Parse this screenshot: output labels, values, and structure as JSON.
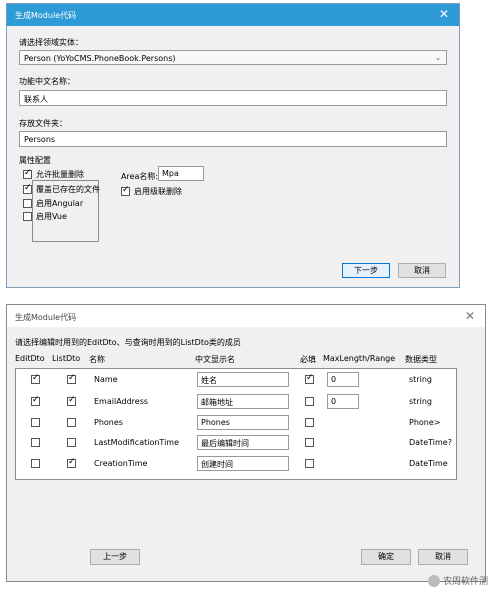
{
  "dialog1": {
    "title": "生成Module代码",
    "entity_label": "请选择领域实体：",
    "entity_value": "Person (YoYoCMS.PhoneBook.Persons)",
    "cn_name_label": "功能中文名称：",
    "cn_name_value": "联系人",
    "folder_label": "存放文件夹：",
    "folder_value": "Persons",
    "props_label": "属性配置",
    "options": [
      {
        "label": "允许批量删除",
        "checked": true
      },
      {
        "label": "覆盖已存在的文件",
        "checked": true
      },
      {
        "label": "启用Angular",
        "checked": false
      },
      {
        "label": "启用Vue",
        "checked": false
      }
    ],
    "area_label": "Area名称:",
    "area_value": "Mpa",
    "cascade_label": "启用级联删除",
    "cascade_checked": true,
    "next_button": "下一步",
    "cancel_button": "取消"
  },
  "dialog2": {
    "title": "生成Module代码",
    "instruction": "请选择编辑时用到的EditDto、与查询时用到的ListDto类的成员",
    "headers": {
      "editdto": "EditDto",
      "listdto": "ListDto",
      "name": "名称",
      "display": "中文显示名",
      "required": "必填",
      "maxlen": "MaxLength/Range",
      "type": "数据类型"
    },
    "rows": [
      {
        "edit": true,
        "list": true,
        "name": "Name",
        "display": "姓名",
        "required": true,
        "maxlen": "0",
        "type": "string"
      },
      {
        "edit": true,
        "list": true,
        "name": "EmailAddress",
        "display": "邮箱地址",
        "required": false,
        "maxlen": "0",
        "type": "string"
      },
      {
        "edit": false,
        "list": false,
        "name": "Phones",
        "display": "Phones",
        "required": false,
        "maxlen": "",
        "type": "Phone>"
      },
      {
        "edit": false,
        "list": false,
        "name": "LastModificationTime",
        "display": "最后编辑时间",
        "required": false,
        "maxlen": "",
        "type": "DateTime?"
      },
      {
        "edit": false,
        "list": true,
        "name": "CreationTime",
        "display": "创建时间",
        "required": false,
        "maxlen": "",
        "type": "DateTime"
      }
    ],
    "prev_button": "上一步",
    "ok_button": "确定",
    "cancel_button": "取消"
  },
  "watermark": "农周软件测"
}
